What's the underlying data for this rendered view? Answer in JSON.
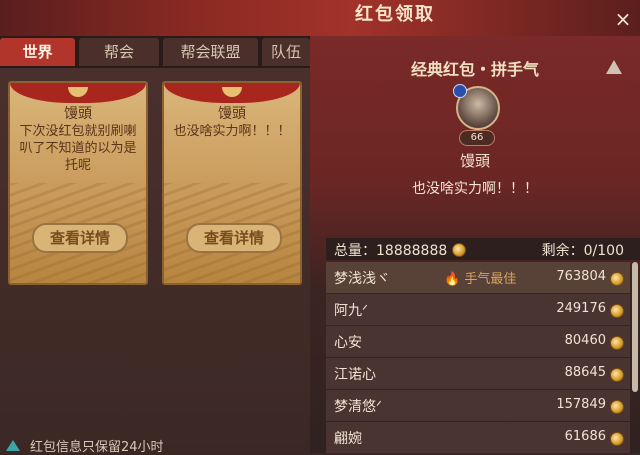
{
  "window": {
    "title": "红包领取",
    "close_label": "×"
  },
  "tabs": [
    {
      "label": "世界",
      "active": true
    },
    {
      "label": "帮会",
      "active": false
    },
    {
      "label": "帮会联盟",
      "active": false
    },
    {
      "label": "队伍",
      "active": false
    }
  ],
  "cards": [
    {
      "name": "馒頭",
      "message": "下次没红包就别刷喇叭了不知道的以为是托呢",
      "button": "查看详情"
    },
    {
      "name": "馒頭",
      "message": "也没啥实力啊！！！",
      "button": "查看详情"
    }
  ],
  "footer": {
    "text": "红包信息只保留24小时"
  },
  "detail": {
    "title": "经典红包・拼手气",
    "sender": {
      "name": "馒頭",
      "level": "66",
      "message": "也没啥实力啊！！！"
    },
    "total_label": "总量：",
    "total_value": "18888888",
    "remain_label": "剩余：",
    "remain_value": "0/100",
    "best_label": "手气最佳",
    "rows": [
      {
        "name": "梦浅浅ヾ",
        "amount": "763804",
        "best": true
      },
      {
        "name": "阿九ᐟ",
        "amount": "249176",
        "best": false
      },
      {
        "name": "心安",
        "amount": "80460",
        "best": false
      },
      {
        "name": "江诺心",
        "amount": "88645",
        "best": false
      },
      {
        "name": "梦清悠ᐟ",
        "amount": "157849",
        "best": false
      },
      {
        "name": "翩婉",
        "amount": "61686",
        "best": false
      }
    ]
  },
  "colors": {
    "accent_red": "#b2352c",
    "gold": "#d29a2a",
    "teal": "#3ba6a8"
  }
}
